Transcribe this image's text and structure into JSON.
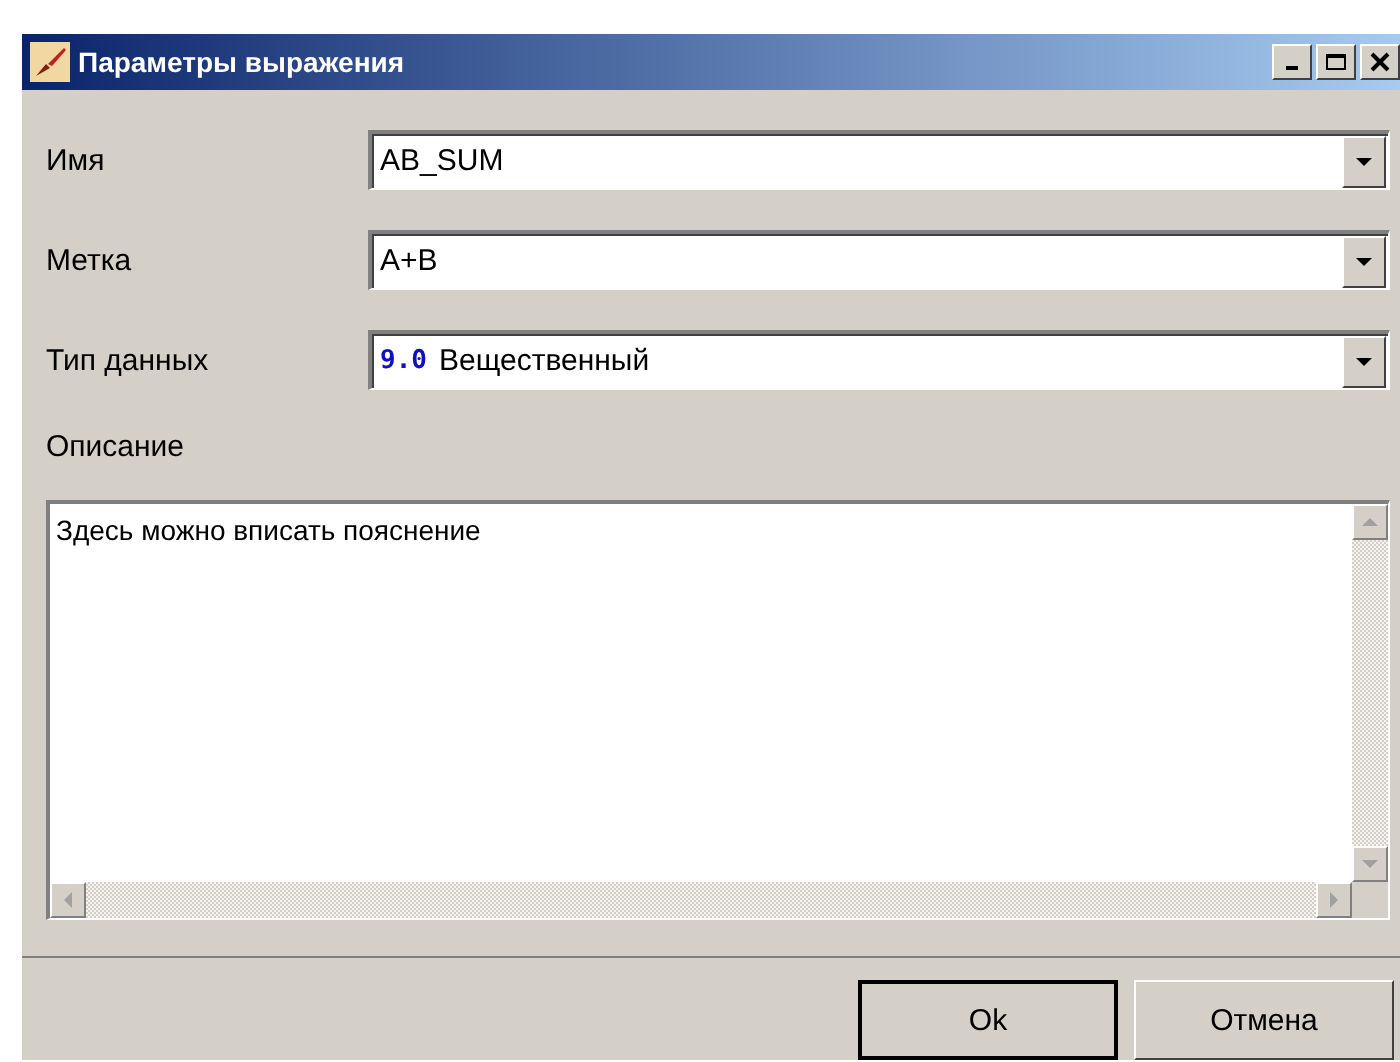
{
  "window": {
    "title": "Параметры выражения"
  },
  "fields": [
    {
      "label": "Имя",
      "value": "AB_SUM"
    },
    {
      "label": "Метка",
      "value": "A+B"
    },
    {
      "label": "Тип данных",
      "type_badge": "9.0",
      "value": "Вещественный"
    }
  ],
  "description": {
    "label": "Описание",
    "value": "Здесь можно вписать пояснение"
  },
  "buttons": [
    {
      "label": "Ok",
      "default": true
    },
    {
      "label": "Отмена",
      "default": false
    }
  ]
}
